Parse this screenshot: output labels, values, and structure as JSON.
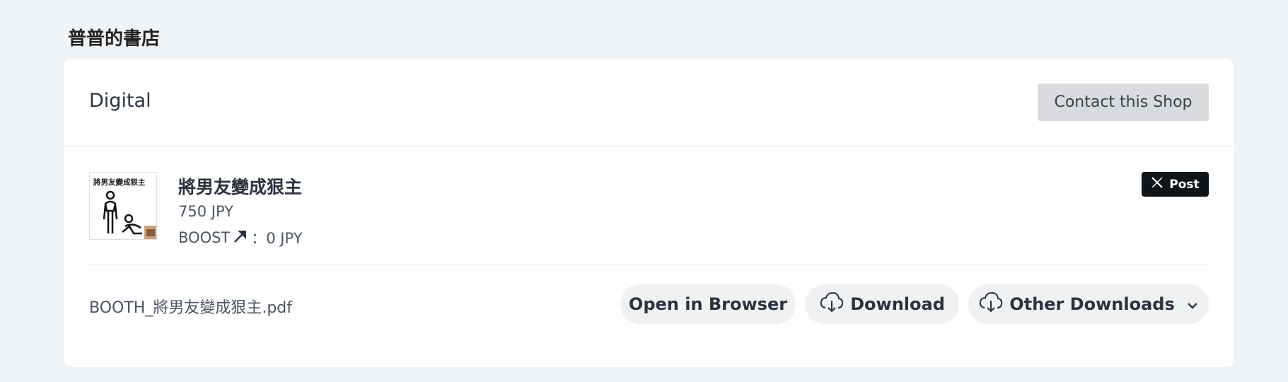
{
  "shop": {
    "name": "普普的書店"
  },
  "card": {
    "category": "Digital",
    "contact_label": "Contact this Shop"
  },
  "item": {
    "title": "將男友變成狠主",
    "price": "750 JPY",
    "boost_label": "BOOST",
    "boost_value": "：0 JPY",
    "thumbnail_text": "將男友變成狠主",
    "post_label": "Post"
  },
  "file": {
    "name": "BOOTH_將男友變成狠主.pdf",
    "open_label": "Open in Browser",
    "download_label": "Download",
    "other_label": "Other Downloads"
  },
  "icons": {
    "boost": "arrow-up-right-icon",
    "post": "x-logo-icon",
    "download": "cloud-download-icon",
    "dropdown": "chevron-down-icon"
  },
  "colors": {
    "page_bg": "#f0f4f7",
    "card_bg": "#ffffff",
    "contact_bg": "#d9dbde",
    "post_bg": "#0f1419",
    "pill_bg": "#f0f1f2",
    "text": "#2b3340"
  }
}
